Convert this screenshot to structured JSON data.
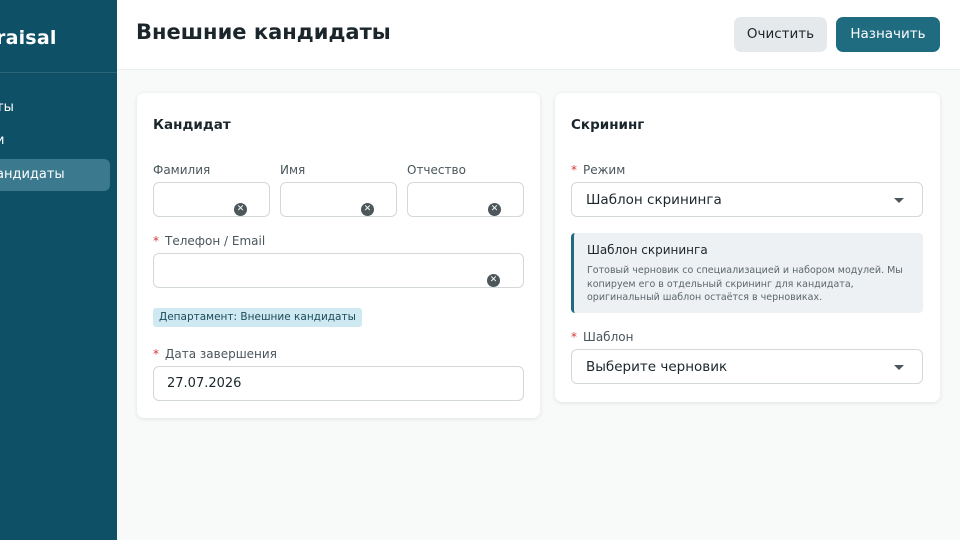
{
  "sidebar": {
    "brand": "raisal",
    "items": [
      {
        "label": "ты"
      },
      {
        "label": "и"
      },
      {
        "label": "андидаты"
      }
    ]
  },
  "header": {
    "title": "Внешние кандидаты",
    "clear_label": "Очистить",
    "assign_label": "Назначить"
  },
  "candidate": {
    "title": "Кандидат",
    "last_name_label": "Фамилия",
    "first_name_label": "Имя",
    "middle_name_label": "Отчество",
    "required_mark": "*",
    "contact_label": "Телефон / Email",
    "department_badge": "Департамент: Внешние кандидаты",
    "due_date_label": "Дата завершения",
    "due_date_value": "27.07.2026"
  },
  "screening": {
    "title": "Скрининг",
    "mode_label": "Режим",
    "mode_value": "Шаблон скрининга",
    "info_title": "Шаблон скрининга",
    "info_text": "Готовый черновик со специализацией и набором модулей. Мы копируем его в отдельный скрининг для кандидата, оригинальный шаблон остаётся в черновиках.",
    "template_label": "Шаблон",
    "template_value": "Выберите черновик"
  },
  "icons": {
    "clear": "close-circle-icon",
    "dropdown": "caret-down-icon"
  },
  "colors": {
    "sidebar": "#0e5066",
    "accent": "#1f6b80",
    "active_nav": "#3b7a8e",
    "badge_bg": "#cfe9f2",
    "required": "#d23b3b"
  }
}
